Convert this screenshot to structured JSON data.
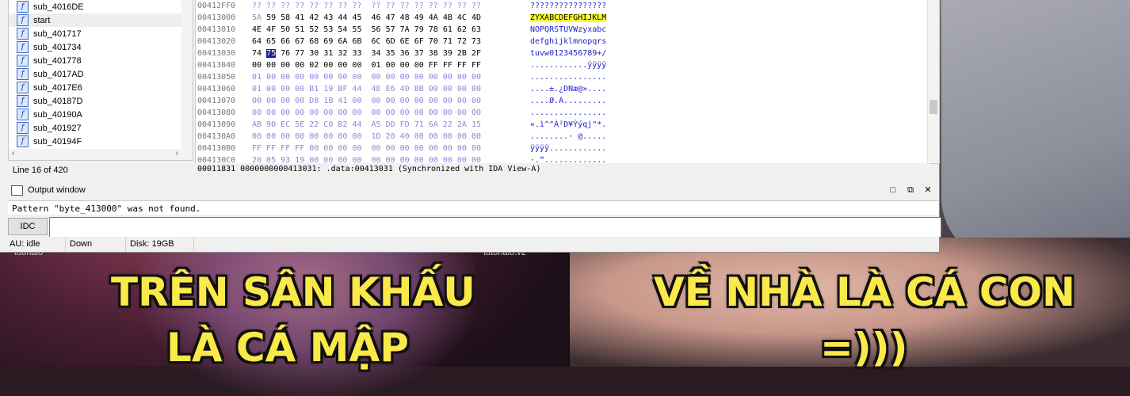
{
  "functions": {
    "items": [
      "sub_4016DE",
      "start",
      "sub_401717",
      "sub_401734",
      "sub_401778",
      "sub_4017AD",
      "sub_4017E6",
      "sub_40187D",
      "sub_40190A",
      "sub_401927",
      "sub_40194F"
    ],
    "selected_index": 1,
    "line_info": "Line 16 of 420"
  },
  "hex_view": {
    "rows": [
      {
        "addr": "00412FF0",
        "bytes": "?? ?? ?? ?? ?? ?? ?? ??  ?? ?? ?? ?? ?? ?? ?? ??",
        "ascii": "????????????????"
      },
      {
        "addr": "00413000",
        "bytes_pre": "",
        "byte_hl": "",
        "bytes_first": "5A",
        "bytes": "59 58 41 42 43 44 45  46 47 48 49 4A 4B 4C 4D",
        "ascii_hl": "ZYXABCDEFGHIJKLM"
      },
      {
        "addr": "00413010",
        "bytes": "4E 4F 50 51 52 53 54 55  56 57 7A 79 78 61 62 63",
        "ascii": "NOPQRSTUVWzyxabc"
      },
      {
        "addr": "00413020",
        "bytes": "64 65 66 67 68 69 6A 6B  6C 6D 6E 6F 70 71 72 73",
        "ascii": "defghijklmnopqrs"
      },
      {
        "addr": "00413030",
        "bytes_pre": "74 ",
        "byte_hl": "75",
        "bytes": " 76 77 30 31 32 33  34 35 36 37 38 39 2B 2F",
        "ascii": "tuvw0123456789+/"
      },
      {
        "addr": "00413040",
        "bytes": "00 00 00 00 02 00 00 00  01 00 00 00 FF FF FF FF",
        "ascii": "............ÿÿÿÿ"
      },
      {
        "addr": "00413050",
        "bytes": "01 00 00 00 00 00 00 00  00 00 00 00 00 00 00 00",
        "ascii": "................"
      },
      {
        "addr": "00413060",
        "bytes": "01 00 00 00 B1 19 BF 44  4E E6 40 BB 00 00 00 00",
        "ascii": "....±.¿DNæ@»...."
      },
      {
        "addr": "00413070",
        "bytes": "00 00 00 00 D8 1B 41 00  00 00 00 00 00 00 00 00",
        "ascii": "....Ø.A........."
      },
      {
        "addr": "00413080",
        "bytes": "00 00 00 00 00 00 00 00  00 00 00 00 00 00 00 00",
        "ascii": "................"
      },
      {
        "addr": "00413090",
        "bytes": "AB 90 EC 5E 22 C0 B2 44  A5 DD FD 71 6A 22 2A 15",
        "ascii": "«.ì^\"À²D¥Ýýqj\"*."
      },
      {
        "addr": "004130A0",
        "bytes": "00 00 00 00 00 00 00 00  1D 20 40 00 00 00 00 00",
        "ascii": "........· @....."
      },
      {
        "addr": "004130B0",
        "bytes": "FF FF FF FF 00 00 00 00  00 00 00 00 00 00 00 00",
        "ascii": "ÿÿÿÿ............"
      },
      {
        "addr": "004130C0",
        "bytes": "20 05 93 19 00 00 00 00  00 00 00 00 00 00 00 00",
        "ascii": "·.“............."
      }
    ],
    "status_text": "00011831 0000000000413031: .data:00413031 (Synchronized with IDA View-A)"
  },
  "output_window": {
    "title": "Output window",
    "message": "Pattern \"byte_413000\" was not found.",
    "idc_label": "IDC",
    "idc_value": ""
  },
  "status_bar": {
    "au": "AU:  idle",
    "direction": "Down",
    "disk": "Disk: 19GB"
  },
  "captions": {
    "left_line1": "TRÊN SÂN KHẤU",
    "left_line2": "LÀ CÁ MẬP",
    "right_line1": "VỀ NHÀ LÀ CÁ CON",
    "right_line2": "=)))"
  },
  "watermarks": {
    "left": "tuohaio",
    "right": "tutohalo.v2"
  },
  "icons": {
    "function": "function-icon",
    "output": "window-icon",
    "maximize": "maximize-icon",
    "restore": "restore-icon",
    "close": "close-icon"
  },
  "colors": {
    "caption_fill": "#fbe94a",
    "hex_ascii": "#1f1fc8",
    "highlight_yellow": "#ffff33",
    "selected_byte": "#1b1b9a"
  }
}
